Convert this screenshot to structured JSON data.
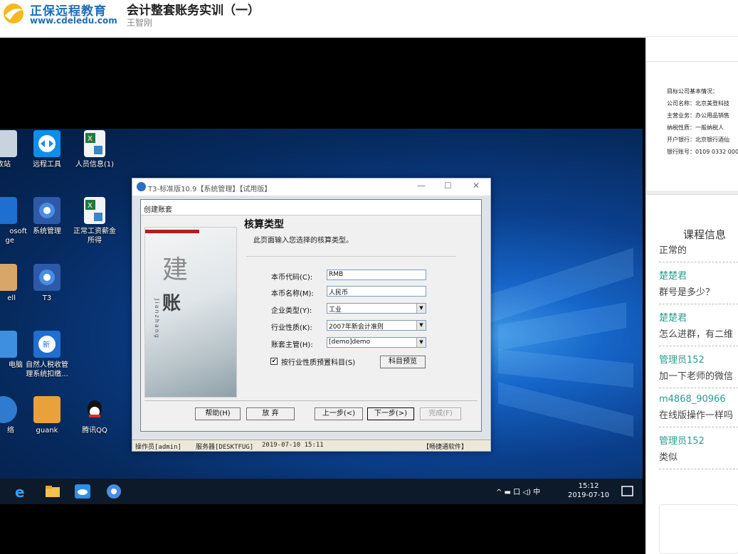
{
  "header": {
    "brand_name": "正保远程教育",
    "brand_url": "www.cdeledu.com",
    "course_title": "会计整套账务实训（一）",
    "teacher": "王智刚"
  },
  "desktop": {
    "icons": [
      {
        "label": "收站"
      },
      {
        "label": "远程工具"
      },
      {
        "label": "人员信息(1)"
      },
      {
        "label": "osoft"
      },
      {
        "label": "ge"
      },
      {
        "label": "系统管理"
      },
      {
        "label": "正常工资薪金"
      },
      {
        "label": "所得"
      },
      {
        "label": "ell"
      },
      {
        "label": "T3"
      },
      {
        "label": "电脑"
      },
      {
        "label": "自然人税收管"
      },
      {
        "label": "理系统扣缴..."
      },
      {
        "label": "络"
      },
      {
        "label": "guank"
      },
      {
        "label": "腾讯QQ"
      }
    ],
    "clock_time": "15:12",
    "clock_date": "2019-07-10",
    "tray_text": "^ ▬ 口 ◁) 中"
  },
  "t3_window": {
    "title": "T3-标准版10.9【系统管理】【试用版】",
    "status": {
      "operator": "操作员[admin]",
      "server": "服务器[DESKTFUG]",
      "datetime": "2019-07-10 15:11",
      "vendor": "【畅捷通软件】"
    }
  },
  "wizard": {
    "title": "创建账套",
    "art_char1": "建",
    "art_char2": "账",
    "art_pinyin": "Jianzhang",
    "heading": "核算类型",
    "subtitle": "此页面输入您选择的核算类型。",
    "fields": [
      {
        "label": "本币代码(C):",
        "value": "RMB"
      },
      {
        "label": "本币名称(M):",
        "value": "人民币"
      },
      {
        "label": "企业类型(Y):",
        "value": "工业"
      },
      {
        "label": "行业性质(K):",
        "value": "2007年新会计准则"
      },
      {
        "label": "账套主管(H):",
        "value": "[demo]demo"
      }
    ],
    "checkbox_label": "按行业性质预置科目(S)",
    "checkbox_mark": "✔",
    "buttons": {
      "preview": "科目预览",
      "help": "帮助(H)",
      "cancel": "放 弃",
      "prev": "上一步(<)",
      "next": "下一步(>)",
      "finish": "完成(F)"
    }
  },
  "side": {
    "slide_lines": [
      "目标公司基本情况：",
      "公司名称：北京美登科技",
      "主营业务：办公用品销售",
      "纳税性质：一般纳税人",
      "开户银行：北京银行酒仙",
      "银行账号：0109 0332 000"
    ],
    "section_title": "课程信息",
    "messages": [
      {
        "user": "",
        "text": "正常的"
      },
      {
        "user": "楚楚君",
        "text": "群号是多少？"
      },
      {
        "user": "楚楚君",
        "text": "怎么进群，有二维"
      },
      {
        "user": "管理员152",
        "text": "加一下老师的微信"
      },
      {
        "user": "m4868_90966",
        "text": "在线版操作一样吗"
      },
      {
        "user": "管理员152",
        "text": "类似"
      }
    ]
  }
}
